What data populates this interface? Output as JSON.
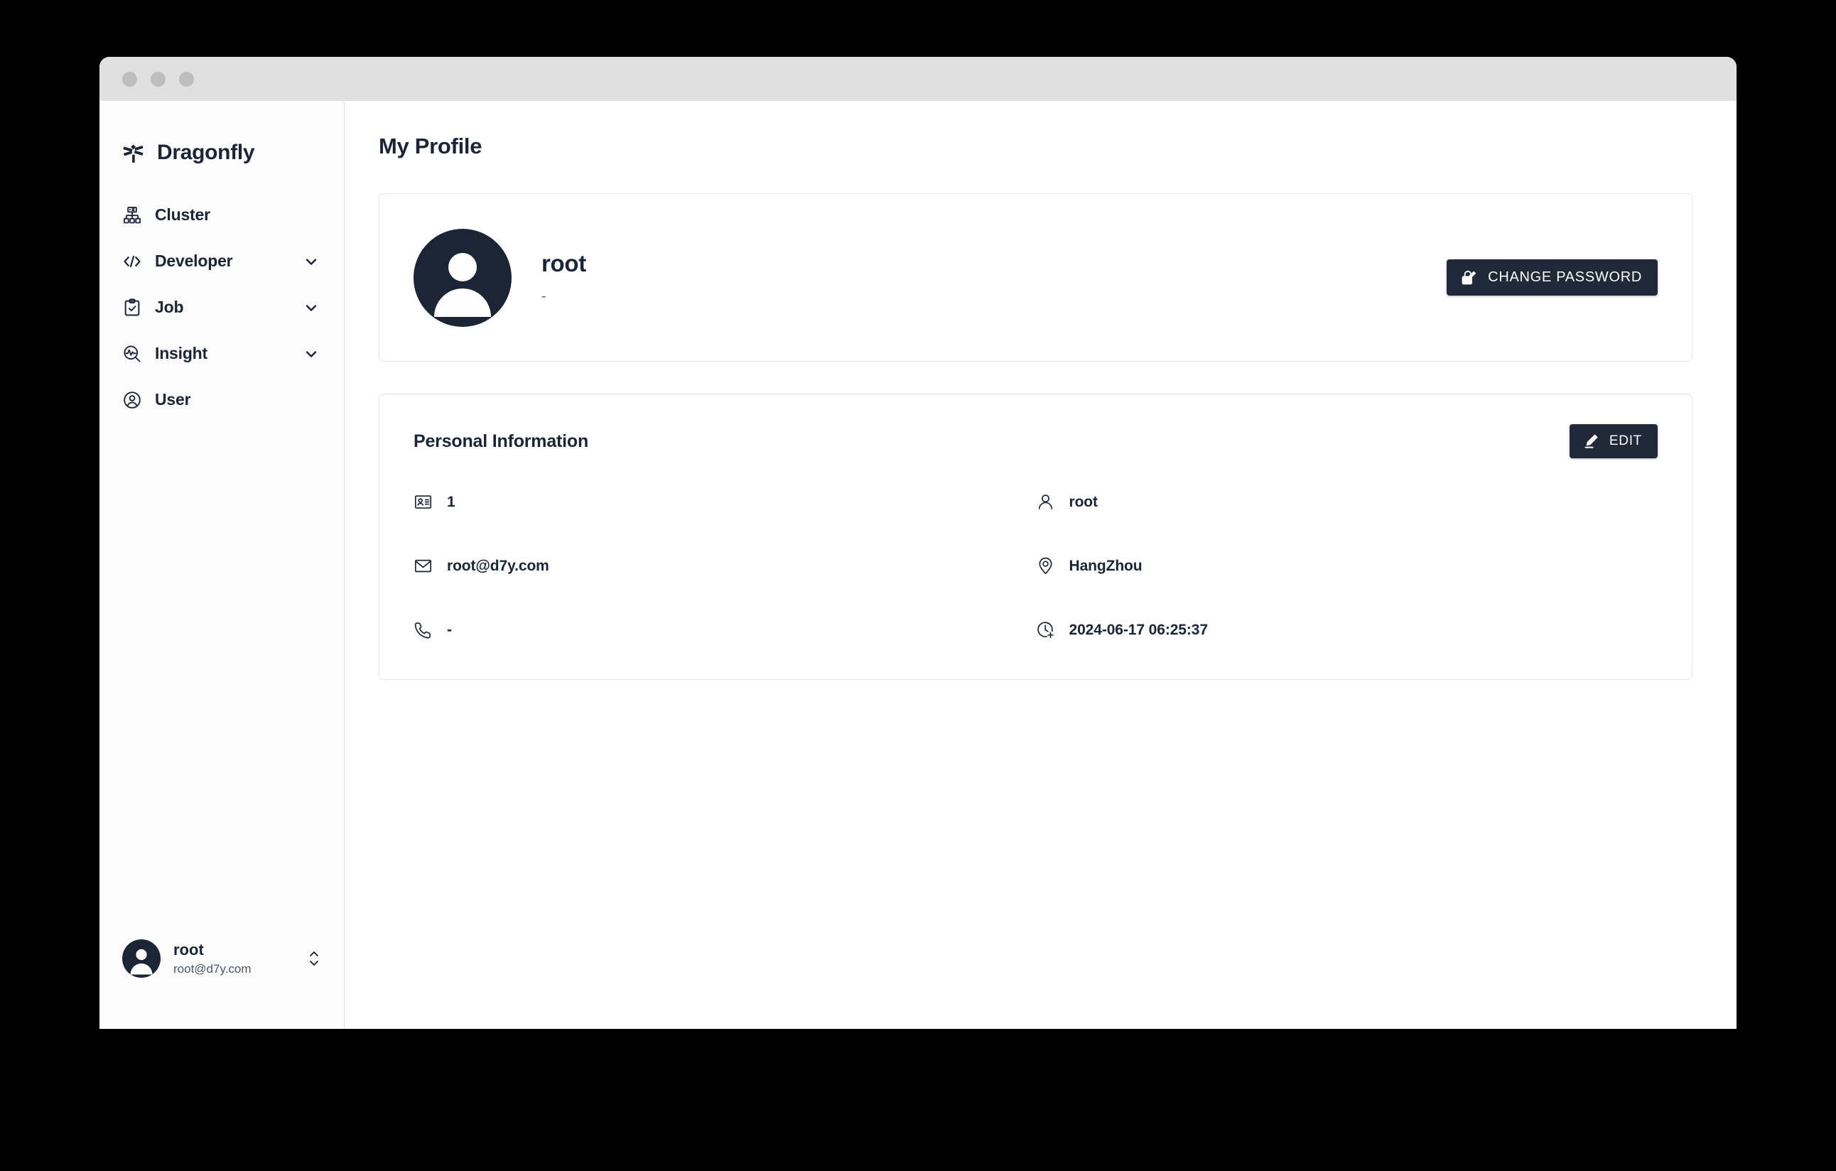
{
  "window": {
    "traffic_lights": [
      "close",
      "minimize",
      "maximize"
    ]
  },
  "sidebar": {
    "brand": {
      "label": "Dragonfly",
      "icon": "dragonfly-logo-icon"
    },
    "items": [
      {
        "label": "Cluster",
        "icon": "cluster-icon",
        "expandable": false
      },
      {
        "label": "Developer",
        "icon": "code-icon",
        "expandable": true
      },
      {
        "label": "Job",
        "icon": "clipboard-check-icon",
        "expandable": true
      },
      {
        "label": "Insight",
        "icon": "insight-search-icon",
        "expandable": true
      },
      {
        "label": "User",
        "icon": "user-circle-icon",
        "expandable": false
      }
    ],
    "footer": {
      "name": "root",
      "email": "root@d7y.com",
      "switch_icon": "chevron-up-down-icon",
      "avatar_icon": "avatar-icon"
    }
  },
  "main": {
    "page_title": "My Profile",
    "profile_card": {
      "avatar_icon": "avatar-icon",
      "name": "root",
      "subtitle": "-",
      "change_password_button": {
        "label": "CHANGE PASSWORD",
        "icon": "lock-edit-icon"
      }
    },
    "personal_information": {
      "title": "Personal Information",
      "edit_button": {
        "label": "EDIT",
        "icon": "pencil-icon"
      },
      "fields": [
        {
          "icon": "id-card-icon",
          "value": "1"
        },
        {
          "icon": "person-icon",
          "value": "root"
        },
        {
          "icon": "email-icon",
          "value": "root@d7y.com"
        },
        {
          "icon": "location-pin-icon",
          "value": "HangZhou"
        },
        {
          "icon": "phone-icon",
          "value": "-"
        },
        {
          "icon": "clock-plus-icon",
          "value": "2024-06-17 06:25:37"
        }
      ]
    }
  },
  "colors": {
    "accent_dark": "#1c2536",
    "button_bg": "#1f2937",
    "page_bg": "#ffffff",
    "sidebar_bg": "#fdfcfc",
    "titlebar_bg": "#e0e0e0",
    "card_border": "#e6e6e6",
    "desktop_bg": "#000000"
  }
}
